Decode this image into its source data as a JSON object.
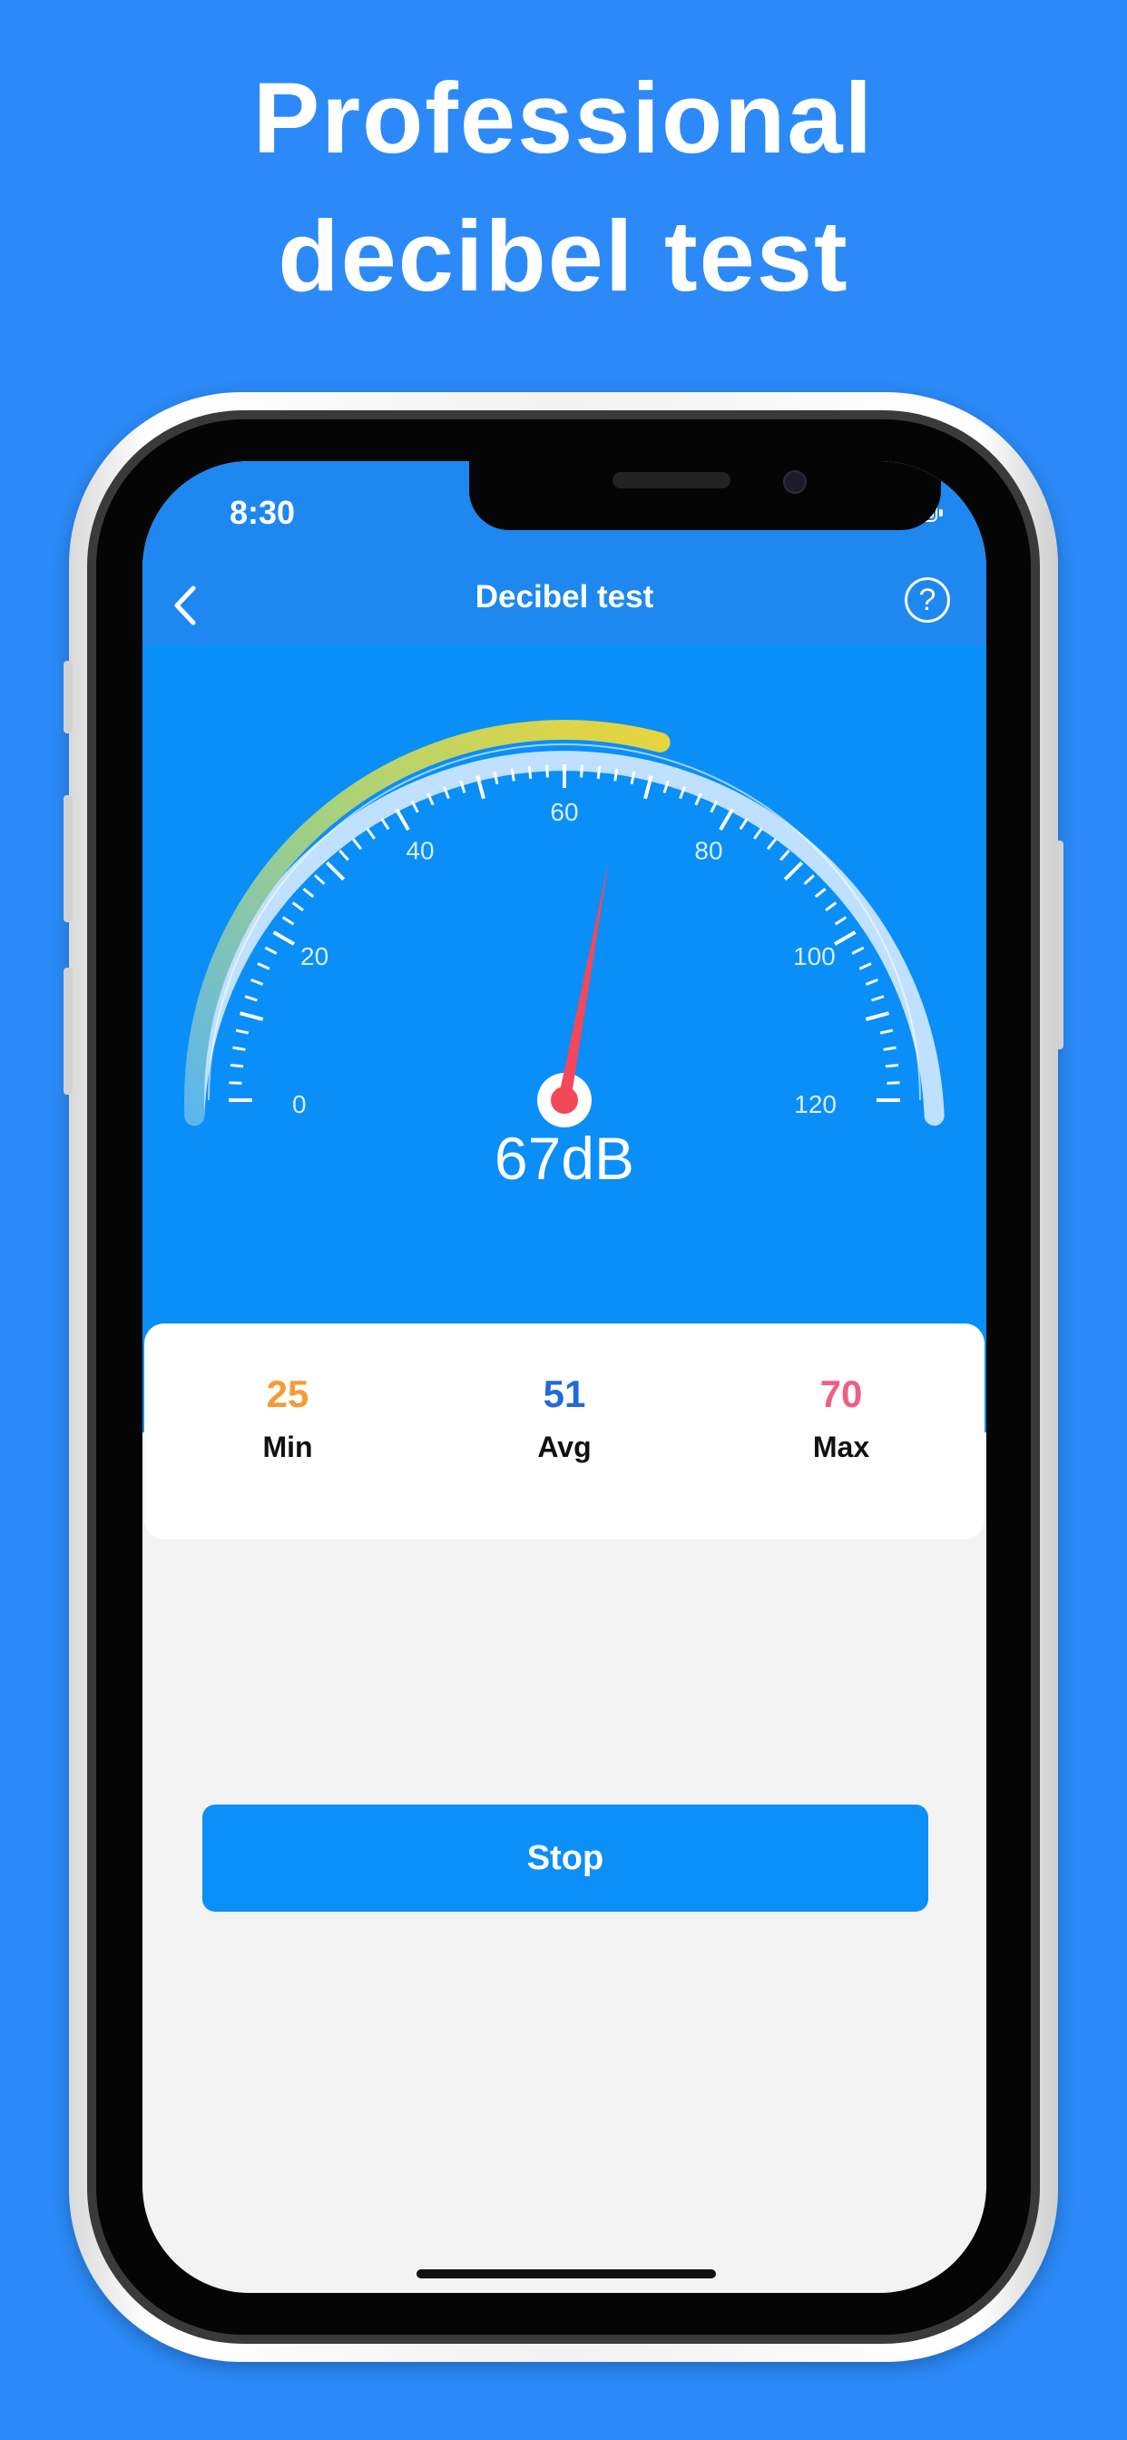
{
  "promo": {
    "line1": "Professional",
    "line2": "decibel test"
  },
  "status_bar": {
    "time": "8:30",
    "signal_icon": "signal-dots-icon",
    "wifi_icon": "wifi-icon",
    "battery_icon": "battery-icon"
  },
  "nav": {
    "title": "Decibel test",
    "back_icon": "chevron-left-icon",
    "help_label": "?"
  },
  "gauge": {
    "min": 0,
    "max": 120,
    "tick_labels": [
      "0",
      "20",
      "40",
      "60",
      "80",
      "100",
      "120"
    ],
    "needle_value": 67,
    "level_value": 70,
    "colors": {
      "track": "#BFE1FF",
      "gradient_start": "#5BB6EE",
      "gradient_mid": "#A9D27A",
      "gradient_end": "#E9D53C",
      "needle": "#F4475A"
    }
  },
  "reading": "67dB",
  "stats": {
    "min": {
      "value": "25",
      "label": "Min",
      "color": "#F59B35"
    },
    "avg": {
      "value": "51",
      "label": "Avg",
      "color": "#2269D9"
    },
    "max": {
      "value": "70",
      "label": "Max",
      "color": "#EF5E84"
    }
  },
  "stop_button": "Stop"
}
